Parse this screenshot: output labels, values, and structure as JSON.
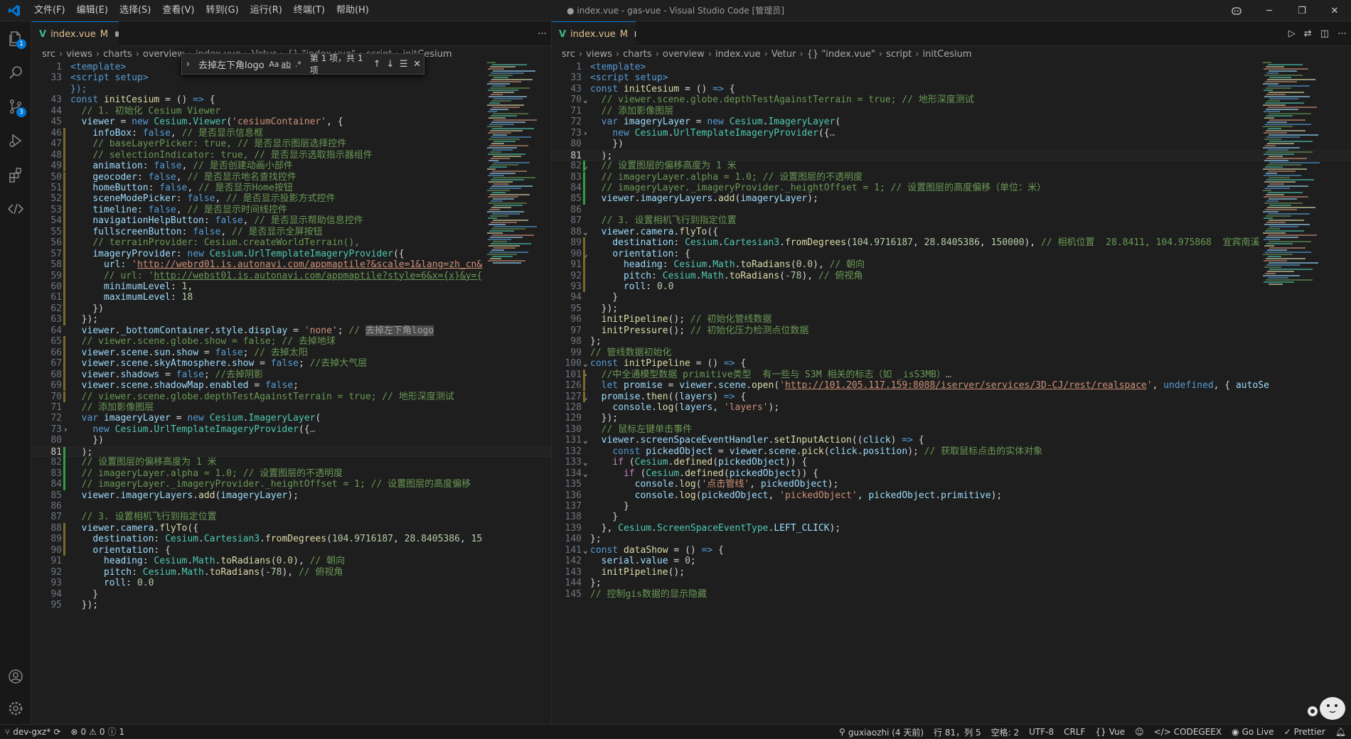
{
  "title_bar": {
    "menus": [
      "文件(F)",
      "编辑(E)",
      "选择(S)",
      "查看(V)",
      "转到(G)",
      "运行(R)",
      "终端(T)",
      "帮助(H)"
    ],
    "window_title": "● index.vue - gas-vue - Visual Studio Code [管理员]"
  },
  "activity_bar": {
    "badges": {
      "explorer": "1",
      "scm": "3"
    }
  },
  "left_editor": {
    "tab": {
      "name": "index.vue",
      "status": "M"
    },
    "breadcrumbs": [
      "src",
      "views",
      "charts",
      "overview",
      "index.vue",
      "Vetur",
      "{} \"index.vue\"",
      "script",
      "initCesium"
    ],
    "find_widget": {
      "query": "去掉左下角logo",
      "opt_case": "Aa",
      "opt_word": "ab",
      "opt_regex": ".*",
      "count": "第 1 项，共 1 项"
    },
    "lines": [
      {
        "n": "1",
        "html": "<span class=\"k\">&lt;template&gt;</span>"
      },
      {
        "n": "33",
        "html": "<span class=\"k\">&lt;script setup&gt;</span>"
      },
      {
        "n": "",
        "html": "<span class=\"k\">});</span>"
      },
      {
        "n": "43",
        "html": "<span class=\"k\">const</span> <span class=\"f\">initCesium</span> = () <span class=\"k\">=&gt;</span> {"
      },
      {
        "n": "44",
        "html": "  <span class=\"c\">// 1. 初始化 Cesium Viewer</span>"
      },
      {
        "n": "45",
        "html": "  <span class=\"v\">viewer</span> = <span class=\"k\">new</span> <span class=\"t\">Cesium</span>.<span class=\"t\">Viewer</span>(<span class=\"s\">'cesiumContainer'</span>, {"
      },
      {
        "n": "46",
        "html": "    <span class=\"v\">infoBox</span>: <span class=\"k\">false</span>, <span class=\"c\">// 是否显示信息框</span>"
      },
      {
        "n": "47",
        "html": "    <span class=\"c\">// baseLayerPicker: true, // 是否显示图层选择控件</span>"
      },
      {
        "n": "48",
        "html": "    <span class=\"c\">// selectionIndicator: true, // 是否显示选取指示器组件</span>"
      },
      {
        "n": "49",
        "html": "    <span class=\"v\">animation</span>: <span class=\"k\">false</span>, <span class=\"c\">// 是否创建动画小部件</span>"
      },
      {
        "n": "50",
        "html": "    <span class=\"v\">geocoder</span>: <span class=\"k\">false</span>, <span class=\"c\">// 是否显示地名查找控件</span>"
      },
      {
        "n": "51",
        "html": "    <span class=\"v\">homeButton</span>: <span class=\"k\">false</span>, <span class=\"c\">// 是否显示Home按钮</span>"
      },
      {
        "n": "52",
        "html": "    <span class=\"v\">sceneModePicker</span>: <span class=\"k\">false</span>, <span class=\"c\">// 是否显示投影方式控件</span>"
      },
      {
        "n": "53",
        "html": "    <span class=\"v\">timeline</span>: <span class=\"k\">false</span>, <span class=\"c\">// 是否显示时间线控件</span>"
      },
      {
        "n": "54",
        "html": "    <span class=\"v\">navigationHelpButton</span>: <span class=\"k\">false</span>, <span class=\"c\">// 是否显示帮助信息控件</span>"
      },
      {
        "n": "55",
        "html": "    <span class=\"v\">fullscreenButton</span>: <span class=\"k\">false</span>, <span class=\"c\">// 是否显示全屏按钮</span>"
      },
      {
        "n": "56",
        "html": "    <span class=\"c\">// terrainProvider: Cesium.createWorldTerrain(),</span>"
      },
      {
        "n": "57",
        "html": "    <span class=\"v\">imageryProvider</span>: <span class=\"k\">new</span> <span class=\"t\">Cesium</span>.<span class=\"t\">UrlTemplateImageryProvider</span>({"
      },
      {
        "n": "58",
        "html": "      <span class=\"v\">url</span>: <span class=\"s\">'</span><span class=\"u\">http://webrd01.is.autonavi.com/appmaptile?&amp;scale=1&amp;lang=zh_cn&amp;</span>"
      },
      {
        "n": "59",
        "html": "      <span class=\"c\">// url: '</span><span class=\"c\" style=\"text-decoration:underline\">http://webst01.is.autonavi.com/appmaptile?style=6&amp;x={x}&amp;y={</span>"
      },
      {
        "n": "60",
        "html": "      <span class=\"v\">minimumLevel</span>: <span class=\"n\">1</span>,"
      },
      {
        "n": "61",
        "html": "      <span class=\"v\">maximumLevel</span>: <span class=\"n\">18</span>"
      },
      {
        "n": "62",
        "html": "    })"
      },
      {
        "n": "63",
        "html": "  });"
      },
      {
        "n": "64",
        "html": "  <span class=\"v\">viewer</span>.<span class=\"v\">_bottomContainer</span>.<span class=\"v\">style</span>.<span class=\"v\">display</span> = <span class=\"s\">'none'</span>; <span class=\"c\">// </span><span class=\"highlight-word\">去掉左下角logo</span>"
      },
      {
        "n": "65",
        "html": "  <span class=\"c\">// viewer.scene.globe.show = false; // 去掉地球</span>"
      },
      {
        "n": "66",
        "html": "  <span class=\"v\">viewer</span>.<span class=\"v\">scene</span>.<span class=\"v\">sun</span>.<span class=\"v\">show</span> = <span class=\"k\">false</span>; <span class=\"c\">// 去掉太阳</span>"
      },
      {
        "n": "67",
        "html": "  <span class=\"v\">viewer</span>.<span class=\"v\">scene</span>.<span class=\"v\">skyAtmosphere</span>.<span class=\"v\">show</span> = <span class=\"k\">false</span>; <span class=\"c\">//去掉大气层</span>"
      },
      {
        "n": "68",
        "html": "  <span class=\"v\">viewer</span>.<span class=\"v\">shadows</span> = <span class=\"k\">false</span>; <span class=\"c\">//去掉阴影</span>"
      },
      {
        "n": "69",
        "html": "  <span class=\"v\">viewer</span>.<span class=\"v\">scene</span>.<span class=\"v\">shadowMap</span>.<span class=\"v\">enabled</span> = <span class=\"k\">false</span>;"
      },
      {
        "n": "70",
        "html": "  <span class=\"c\">// viewer.scene.globe.depthTestAgainstTerrain = true; // 地形深度测试</span>"
      },
      {
        "n": "71",
        "html": "  <span class=\"c\">// 添加影像图层</span>"
      },
      {
        "n": "72",
        "html": "  <span class=\"k\">var</span> <span class=\"v\">imageryLayer</span> = <span class=\"k\">new</span> <span class=\"t\">Cesium</span>.<span class=\"t\">ImageryLayer</span>("
      },
      {
        "n": "73",
        "html": "    <span class=\"k\">new</span> <span class=\"t\">Cesium</span>.<span class=\"t\">UrlTemplateImageryProvider</span>({<span style=\"color:#888\">…</span>",
        "fold": "›"
      },
      {
        "n": "80",
        "html": "    })"
      },
      {
        "n": "81",
        "html": "  );",
        "cur": true
      },
      {
        "n": "82",
        "html": "  <span class=\"c\">// 设置图层的偏移高度为 1 米</span>"
      },
      {
        "n": "83",
        "html": "  <span class=\"c\">// imageryLayer.alpha = 1.0; // 设置图层的不透明度</span>"
      },
      {
        "n": "84",
        "html": "  <span class=\"c\">// imageryLayer._imageryProvider._heightOffset = 1; // 设置图层的高度偏移</span>"
      },
      {
        "n": "85",
        "html": "  <span class=\"v\">viewer</span>.<span class=\"v\">imageryLayers</span>.<span class=\"f\">add</span>(<span class=\"v\">imageryLayer</span>);"
      },
      {
        "n": "86",
        "html": ""
      },
      {
        "n": "87",
        "html": "  <span class=\"c\">// 3. 设置相机飞行到指定位置</span>"
      },
      {
        "n": "88",
        "html": "  <span class=\"v\">viewer</span>.<span class=\"v\">camera</span>.<span class=\"f\">flyTo</span>({"
      },
      {
        "n": "89",
        "html": "    <span class=\"v\">destination</span>: <span class=\"t\">Cesium</span>.<span class=\"t\">Cartesian3</span>.<span class=\"f\">fromDegrees</span>(<span class=\"n\">104.9716187</span>, <span class=\"n\">28.8405386</span>, <span class=\"n\">15</span>"
      },
      {
        "n": "90",
        "html": "    <span class=\"v\">orientation</span>: {"
      },
      {
        "n": "91",
        "html": "      <span class=\"v\">heading</span>: <span class=\"t\">Cesium</span>.<span class=\"t\">Math</span>.<span class=\"f\">toRadians</span>(<span class=\"n\">0.0</span>), <span class=\"c\">// 朝向</span>"
      },
      {
        "n": "92",
        "html": "      <span class=\"v\">pitch</span>: <span class=\"t\">Cesium</span>.<span class=\"t\">Math</span>.<span class=\"f\">toRadians</span>(<span class=\"n\">-78</span>), <span class=\"c\">// 俯视角</span>"
      },
      {
        "n": "93",
        "html": "      <span class=\"v\">roll</span>: <span class=\"n\">0.0</span>"
      },
      {
        "n": "94",
        "html": "    }"
      },
      {
        "n": "95",
        "html": "  });"
      }
    ]
  },
  "right_editor": {
    "tab": {
      "name": "index.vue",
      "status": "M"
    },
    "breadcrumbs": [
      "src",
      "views",
      "charts",
      "overview",
      "index.vue",
      "Vetur",
      "{} \"index.vue\"",
      "script",
      "initCesium"
    ],
    "lines": [
      {
        "n": "1",
        "html": "<span class=\"k\">&lt;template&gt;</span>"
      },
      {
        "n": "33",
        "html": "<span class=\"k\">&lt;script setup&gt;</span>"
      },
      {
        "n": "43",
        "html": "<span class=\"k\">const</span> <span class=\"f\">initCesium</span> = () <span class=\"k\">=&gt;</span> {"
      },
      {
        "n": "70",
        "html": "  <span class=\"c\">// viewer.scene.globe.depthTestAgainstTerrain = true; // 地形深度测试</span>",
        "fold": "⌄"
      },
      {
        "n": "71",
        "html": "  <span class=\"c\">// 添加影像图层</span>"
      },
      {
        "n": "72",
        "html": "  <span class=\"k\">var</span> <span class=\"v\">imageryLayer</span> = <span class=\"k\">new</span> <span class=\"t\">Cesium</span>.<span class=\"t\">ImageryLayer</span>("
      },
      {
        "n": "73",
        "html": "    <span class=\"k\">new</span> <span class=\"t\">Cesium</span>.<span class=\"t\">UrlTemplateImageryProvider</span>({<span style=\"color:#888\">…</span>",
        "fold": "›"
      },
      {
        "n": "80",
        "html": "    })"
      },
      {
        "n": "81",
        "html": "  );",
        "cur": true
      },
      {
        "n": "82",
        "html": "  <span class=\"c\">// 设置图层的偏移高度为 1 米</span>",
        "fold": "⌄"
      },
      {
        "n": "83",
        "html": "  <span class=\"c\">// imageryLayer.alpha = 1.0; // 设置图层的不透明度</span>"
      },
      {
        "n": "84",
        "html": "  <span class=\"c\">// imageryLayer._imageryProvider._heightOffset = 1; // 设置图层的高度偏移（单位：米）</span>"
      },
      {
        "n": "85",
        "html": "  <span class=\"v\">viewer</span>.<span class=\"v\">imageryLayers</span>.<span class=\"f\">add</span>(<span class=\"v\">imageryLayer</span>);"
      },
      {
        "n": "86",
        "html": ""
      },
      {
        "n": "87",
        "html": "  <span class=\"c\">// 3. 设置相机飞行到指定位置</span>"
      },
      {
        "n": "88",
        "html": "  <span class=\"v\">viewer</span>.<span class=\"v\">camera</span>.<span class=\"f\">flyTo</span>({",
        "fold": "⌄"
      },
      {
        "n": "89",
        "html": "    <span class=\"v\">destination</span>: <span class=\"t\">Cesium</span>.<span class=\"t\">Cartesian3</span>.<span class=\"f\">fromDegrees</span>(<span class=\"n\">104.9716187</span>, <span class=\"n\">28.8405386</span>, <span class=\"n\">150000</span>), <span class=\"c\">// 相机位置  28.8411, 104.975868  宜宾南溪</span>"
      },
      {
        "n": "90",
        "html": "    <span class=\"v\">orientation</span>: {",
        "fold": "⌄"
      },
      {
        "n": "91",
        "html": "      <span class=\"v\">heading</span>: <span class=\"t\">Cesium</span>.<span class=\"t\">Math</span>.<span class=\"f\">toRadians</span>(<span class=\"n\">0.0</span>), <span class=\"c\">// 朝向</span>"
      },
      {
        "n": "92",
        "html": "      <span class=\"v\">pitch</span>: <span class=\"t\">Cesium</span>.<span class=\"t\">Math</span>.<span class=\"f\">toRadians</span>(<span class=\"n\">-78</span>), <span class=\"c\">// 俯视角</span>"
      },
      {
        "n": "93",
        "html": "      <span class=\"v\">roll</span>: <span class=\"n\">0.0</span>"
      },
      {
        "n": "94",
        "html": "    }"
      },
      {
        "n": "95",
        "html": "  });"
      },
      {
        "n": "96",
        "html": "  <span class=\"f\">initPipeline</span>(); <span class=\"c\">// 初始化管线数据</span>"
      },
      {
        "n": "97",
        "html": "  <span class=\"f\">initPressure</span>(); <span class=\"c\">// 初始化压力检测点位数据</span>"
      },
      {
        "n": "98",
        "html": "};"
      },
      {
        "n": "99",
        "html": "<span class=\"c\">// 管线数据初始化</span>"
      },
      {
        "n": "100",
        "html": "<span class=\"k\">const</span> <span class=\"f\">initPipeline</span> = () <span class=\"k\">=&gt;</span> {",
        "fold": "⌄"
      },
      {
        "n": "101",
        "html": "  <span class=\"c\">//中全通模型数据 primitive类型  有一些与 S3M 相关的标志（如 _isS3MB）</span><span style=\"color:#888\">…</span>",
        "fold": "›"
      },
      {
        "n": "126",
        "html": "  <span class=\"k\">let</span> <span class=\"v\">promise</span> = <span class=\"v\">viewer</span>.<span class=\"v\">scene</span>.<span class=\"f\">open</span>(<span class=\"s\">'</span><span class=\"u\">http://101.205.117.159:8088/iserver/services/3D-CJ/rest/realspace</span><span class=\"s\">'</span>, <span class=\"k\">undefined</span>, { <span class=\"v\">autoSe</span>"
      },
      {
        "n": "127",
        "html": "  <span class=\"v\">promise</span>.<span class=\"f\">then</span>((<span class=\"v\">layers</span>) <span class=\"k\">=&gt;</span> {",
        "fold": "⌄"
      },
      {
        "n": "128",
        "html": "    <span class=\"v\">console</span>.<span class=\"f\">log</span>(<span class=\"v\">layers</span>, <span class=\"s\">'layers'</span>);"
      },
      {
        "n": "129",
        "html": "  });"
      },
      {
        "n": "130",
        "html": "  <span class=\"c\">// 鼠标左键单击事件</span>"
      },
      {
        "n": "131",
        "html": "  <span class=\"v\">viewer</span>.<span class=\"v\">screenSpaceEventHandler</span>.<span class=\"f\">setInputAction</span>((<span class=\"v\">click</span>) <span class=\"k\">=&gt;</span> {",
        "fold": "⌄"
      },
      {
        "n": "132",
        "html": "    <span class=\"k\">const</span> <span class=\"v\">pickedObject</span> = <span class=\"v\">viewer</span>.<span class=\"v\">scene</span>.<span class=\"f\">pick</span>(<span class=\"v\">click</span>.<span class=\"v\">position</span>); <span class=\"c\">// 获取鼠标点击的实体对象</span>"
      },
      {
        "n": "133",
        "html": "    <span class=\"p\">if</span> (<span class=\"t\">Cesium</span>.<span class=\"f\">defined</span>(<span class=\"v\">pickedObject</span>)) {",
        "fold": "⌄"
      },
      {
        "n": "134",
        "html": "      <span class=\"p\">if</span> (<span class=\"t\">Cesium</span>.<span class=\"f\">defined</span>(<span class=\"v\">pickedObject</span>)) {",
        "fold": "⌄"
      },
      {
        "n": "135",
        "html": "        <span class=\"v\">console</span>.<span class=\"f\">log</span>(<span class=\"s\">'点击管线'</span>, <span class=\"v\">pickedObject</span>);"
      },
      {
        "n": "136",
        "html": "        <span class=\"v\">console</span>.<span class=\"f\">log</span>(<span class=\"v\">pickedObject</span>, <span class=\"s\">'pickedObject'</span>, <span class=\"v\">pickedObject</span>.<span class=\"v\">primitive</span>);"
      },
      {
        "n": "137",
        "html": "      }"
      },
      {
        "n": "138",
        "html": "    }"
      },
      {
        "n": "139",
        "html": "  }, <span class=\"t\">Cesium</span>.<span class=\"t\">ScreenSpaceEventType</span>.<span class=\"v\">LEFT_CLICK</span>);"
      },
      {
        "n": "140",
        "html": "};"
      },
      {
        "n": "141",
        "html": "<span class=\"k\">const</span> <span class=\"f\">dataShow</span> = () <span class=\"k\">=&gt;</span> {",
        "fold": "⌄"
      },
      {
        "n": "142",
        "html": "  <span class=\"v\">serial</span>.<span class=\"v\">value</span> = <span class=\"n\">0</span>;"
      },
      {
        "n": "143",
        "html": "  <span class=\"f\">initPipeline</span>();"
      },
      {
        "n": "144",
        "html": "};"
      },
      {
        "n": "145",
        "html": "<span class=\"c\">// 控制gis数据的显示隐藏</span>"
      }
    ]
  },
  "status_bar": {
    "branch": "dev-gxz*",
    "errors": "0",
    "warnings": "0",
    "info": "1",
    "blame": "guxiaozhi (4 天前)",
    "position": "行 81，列 5",
    "spaces": "空格: 2",
    "encoding": "UTF-8",
    "eol": "CRLF",
    "language": "Vue",
    "codegeex": "CODEGEEX",
    "golive": "Go Live",
    "prettier": "Prettier"
  }
}
